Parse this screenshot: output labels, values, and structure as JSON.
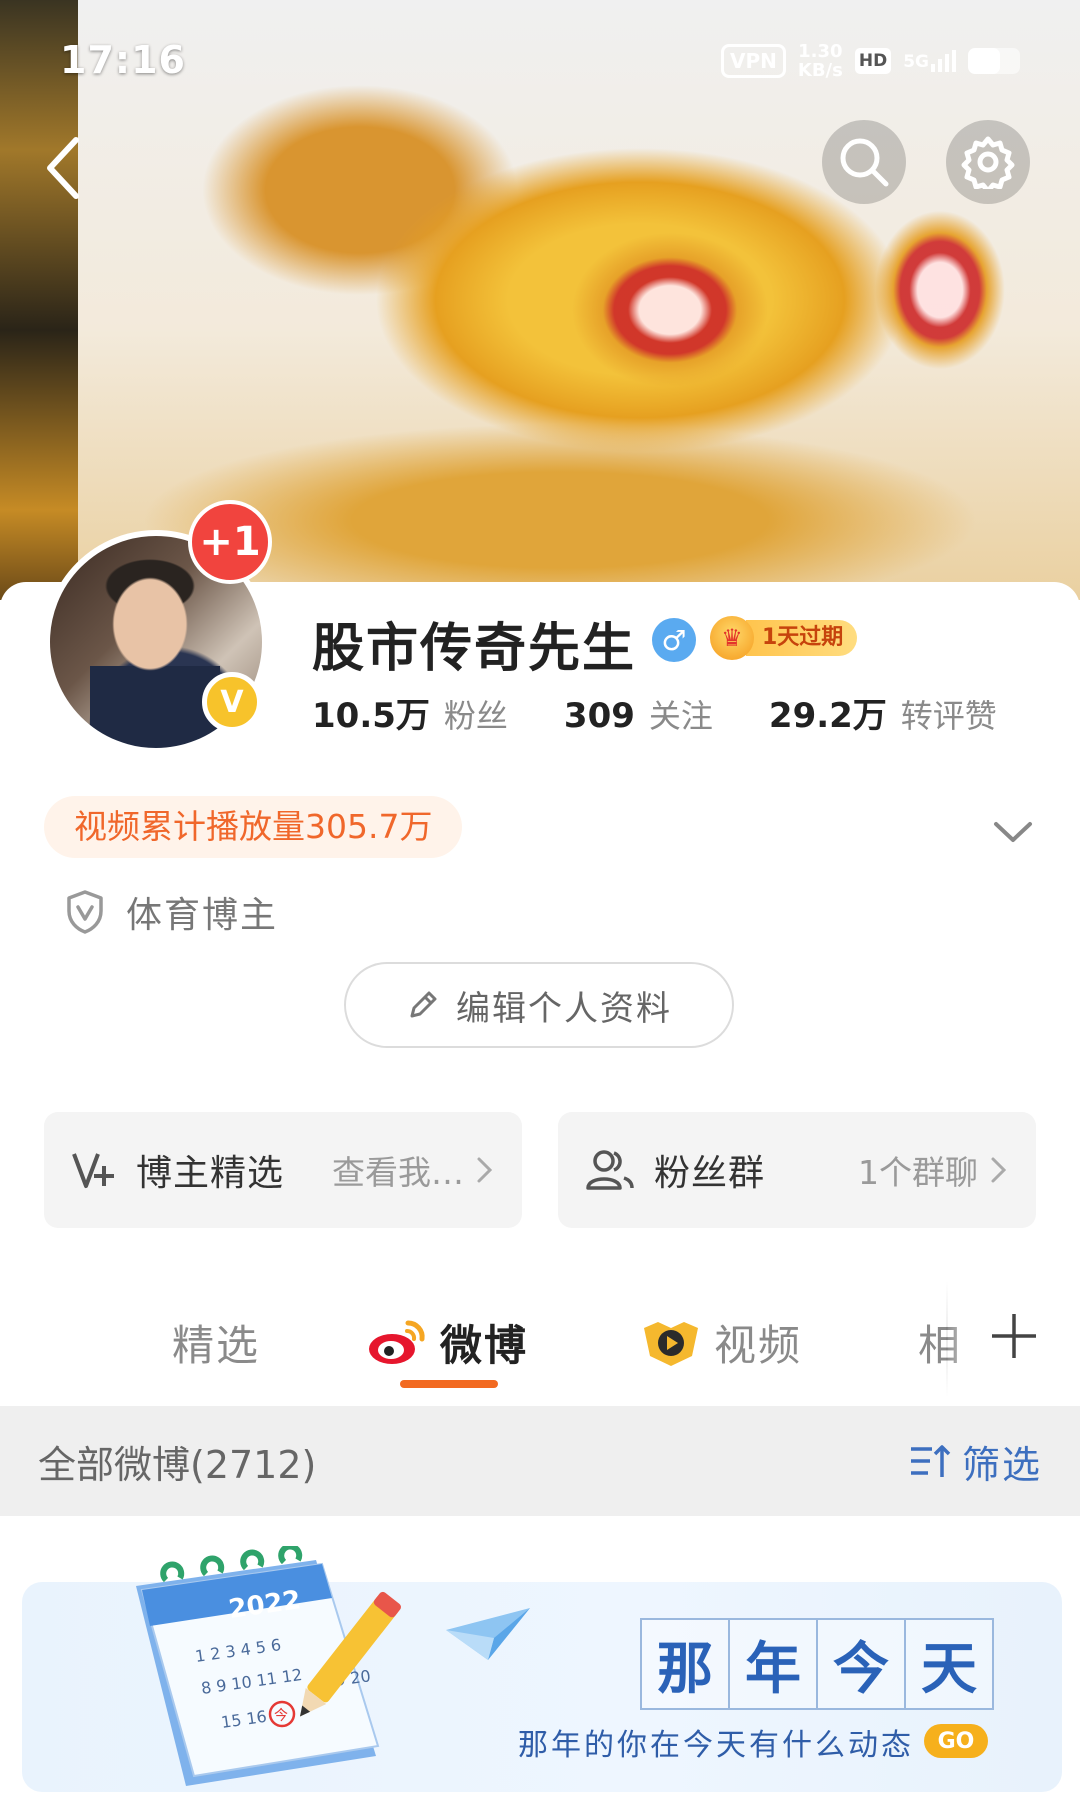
{
  "status_bar": {
    "time": "17:16",
    "vpn": "VPN",
    "net_speed_value": "1.30",
    "net_speed_unit": "KB/s",
    "hd": "HD",
    "network": "5G",
    "battery_level": 0.62
  },
  "header": {
    "back_icon": "chevron-left-icon",
    "search_icon": "search-icon",
    "settings_icon": "gear-icon"
  },
  "profile": {
    "avatar_badge": "+1",
    "verified_mark": "V",
    "nickname": "股市传奇先生",
    "gender_symbol": "♂",
    "member_badge": "1天过期",
    "stats": [
      {
        "value": "10.5万",
        "label": "粉丝"
      },
      {
        "value": "309",
        "label": "关注"
      },
      {
        "value": "29.2万",
        "label": "转评赞"
      }
    ],
    "video_plays": "视频累计播放量305.7万",
    "tag": "体育博主",
    "edit_button": "编辑个人资料"
  },
  "feature_cards": [
    {
      "title": "博主精选",
      "subtitle": "查看我…",
      "icon": "v-plus-icon"
    },
    {
      "title": "粉丝群",
      "subtitle": "1个群聊",
      "icon": "group-icon"
    }
  ],
  "tabs": [
    {
      "label": "精选",
      "active": false
    },
    {
      "label": "微博",
      "active": true,
      "icon": "weibo-logo-icon"
    },
    {
      "label": "视频",
      "active": false,
      "icon": "video-play-icon"
    },
    {
      "label": "相",
      "active": false
    }
  ],
  "filter_bar": {
    "count_label": "全部微博(2712)",
    "filter_label": "筛选"
  },
  "memory_banner": {
    "calendar_year": "2022",
    "calendar_numbers": "1 2 3 4 5 6",
    "calendar_numbers2": "8 9 10 11 12",
    "calendar_numbers3": "15 16",
    "calendar_extra": "9 20",
    "calendar_today": "今",
    "title_chars": [
      "那",
      "年",
      "今",
      "天"
    ],
    "subtitle": "那年的你在今天有什么动态",
    "go": "GO"
  },
  "colors": {
    "accent": "#f26a21",
    "link_blue": "#3d6fbf",
    "badge_red": "#f1443e",
    "vip_gold": "#f7c32b"
  }
}
